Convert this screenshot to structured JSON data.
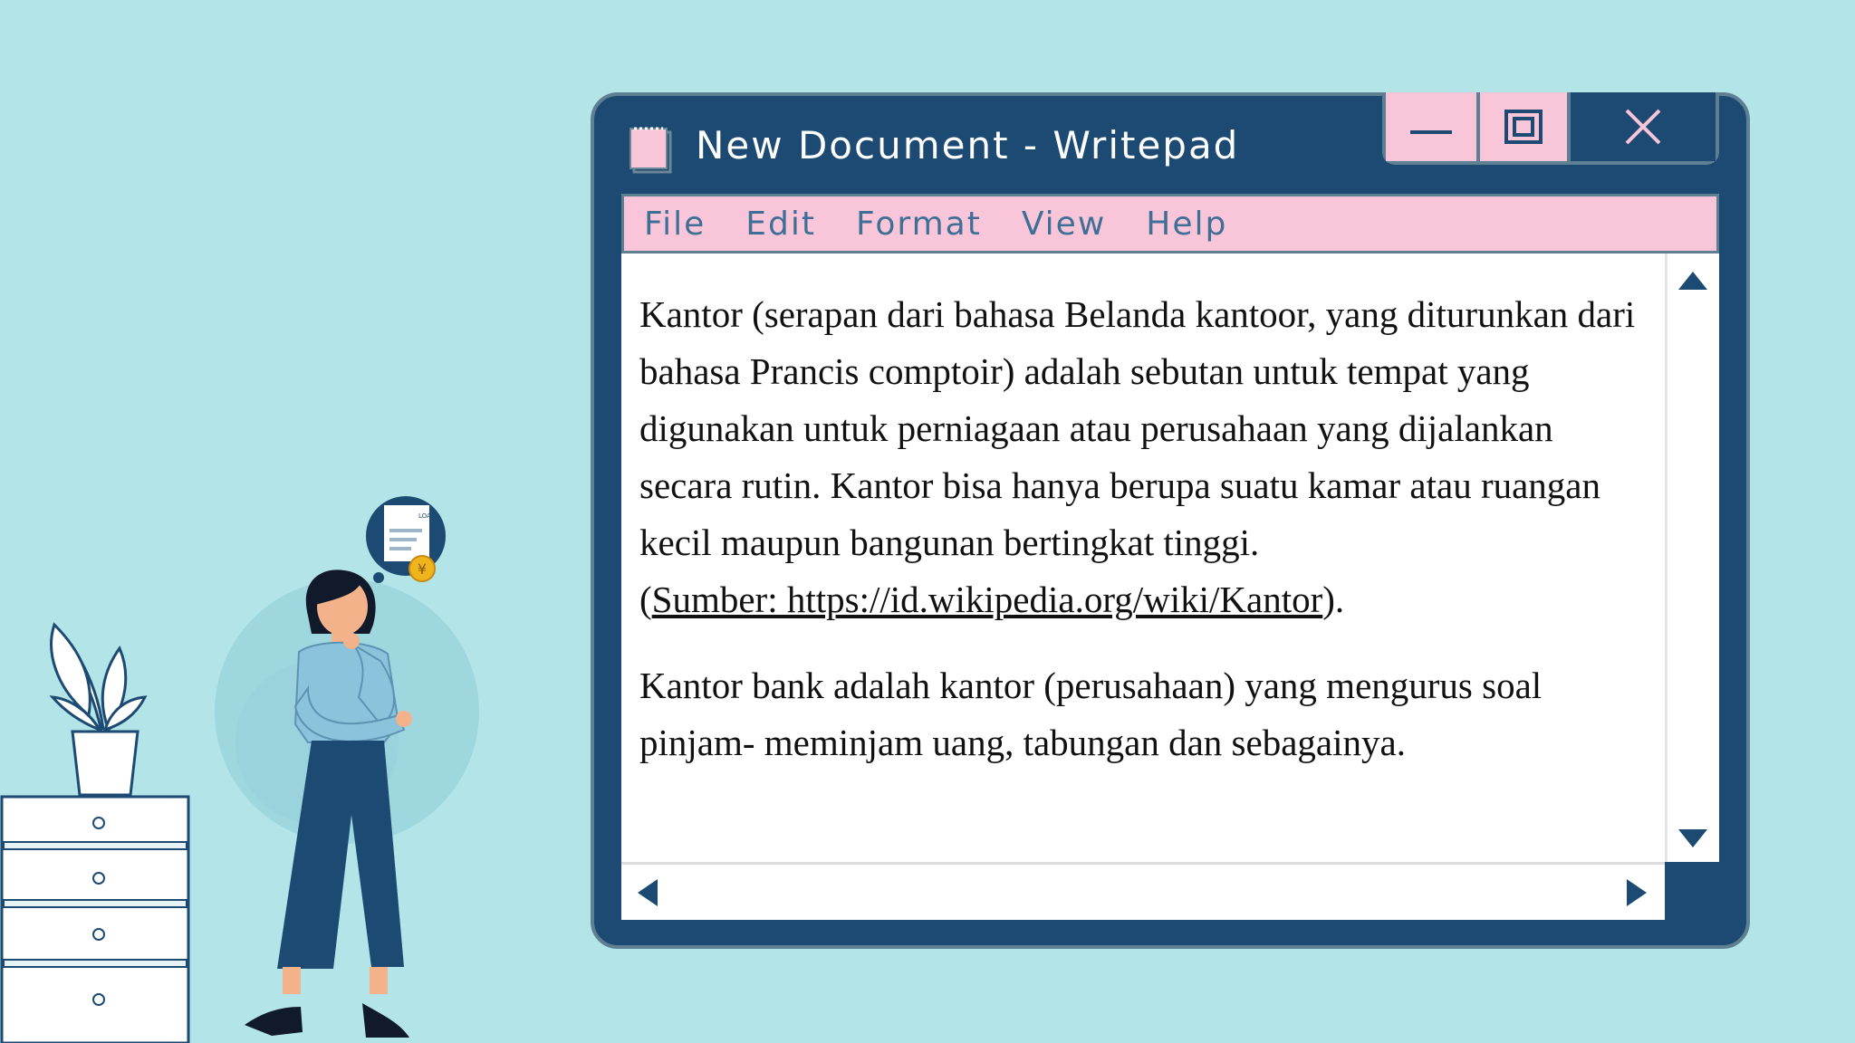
{
  "window": {
    "title": "New Document - Writepad"
  },
  "menu": {
    "items": [
      "File",
      "Edit",
      "Format",
      "View",
      "Help"
    ]
  },
  "document": {
    "paragraph1": "Kantor (serapan dari bahasa Belanda kantoor, yang diturunkan dari bahasa Prancis comptoir) adalah sebutan untuk tempat yang digunakan untuk perniagaan atau perusahaan yang dijalankan secara rutin. Kantor bisa hanya berupa suatu kamar atau ruangan kecil maupun bangunan bertingkat tinggi.",
    "source_open": "(",
    "source_link": "Sumber: https://id.wikipedia.org/wiki/Kantor",
    "source_close": ").",
    "paragraph2": "Kantor bank adalah kantor (perusahaan) yang mengurus soal pinjam- meminjam uang, tabungan dan sebagainya."
  },
  "illustration": {
    "document_badge": "LOAN",
    "coin_symbol": "¥"
  },
  "colors": {
    "background": "#b3e4e8",
    "window_frame": "#1d4a72",
    "accent_pink": "#f8c6d8",
    "menu_text": "#3f6f96",
    "frame_outline": "#5f7f92"
  },
  "icons": {
    "title": "notepad-icon",
    "minimize": "minimize-icon",
    "maximize": "maximize-icon",
    "close": "close-icon",
    "scroll_up": "arrow-up-icon",
    "scroll_down": "arrow-down-icon",
    "scroll_left": "arrow-left-icon",
    "scroll_right": "arrow-right-icon"
  }
}
